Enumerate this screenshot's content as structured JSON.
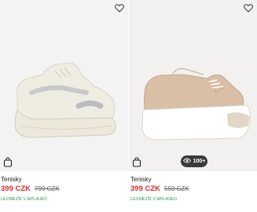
{
  "products": [
    {
      "name": "Tenisky",
      "price": "399 CZK",
      "old_price": "799 CZK",
      "promo": "LEVNĚJŠÍ V APLIKACI",
      "image_bg": "#f3f3f3",
      "shoe_color": "#efece2"
    },
    {
      "name": "Tenisky",
      "price": "399 CZK",
      "old_price": "559 CZK",
      "promo": "LEVNĚJŠÍ V APLIKACI",
      "views": "100+",
      "image_bg": "#f2f1ef",
      "shoe_color": "#d9bfa6"
    }
  ],
  "colors": {
    "price": "#e02b2b",
    "promo": "#1b9a47",
    "badge_bg": "#3a3a3a"
  },
  "icons": {
    "wishlist": "heart-outline-icon",
    "bag": "shopping-bag-icon",
    "views": "eye-icon"
  }
}
